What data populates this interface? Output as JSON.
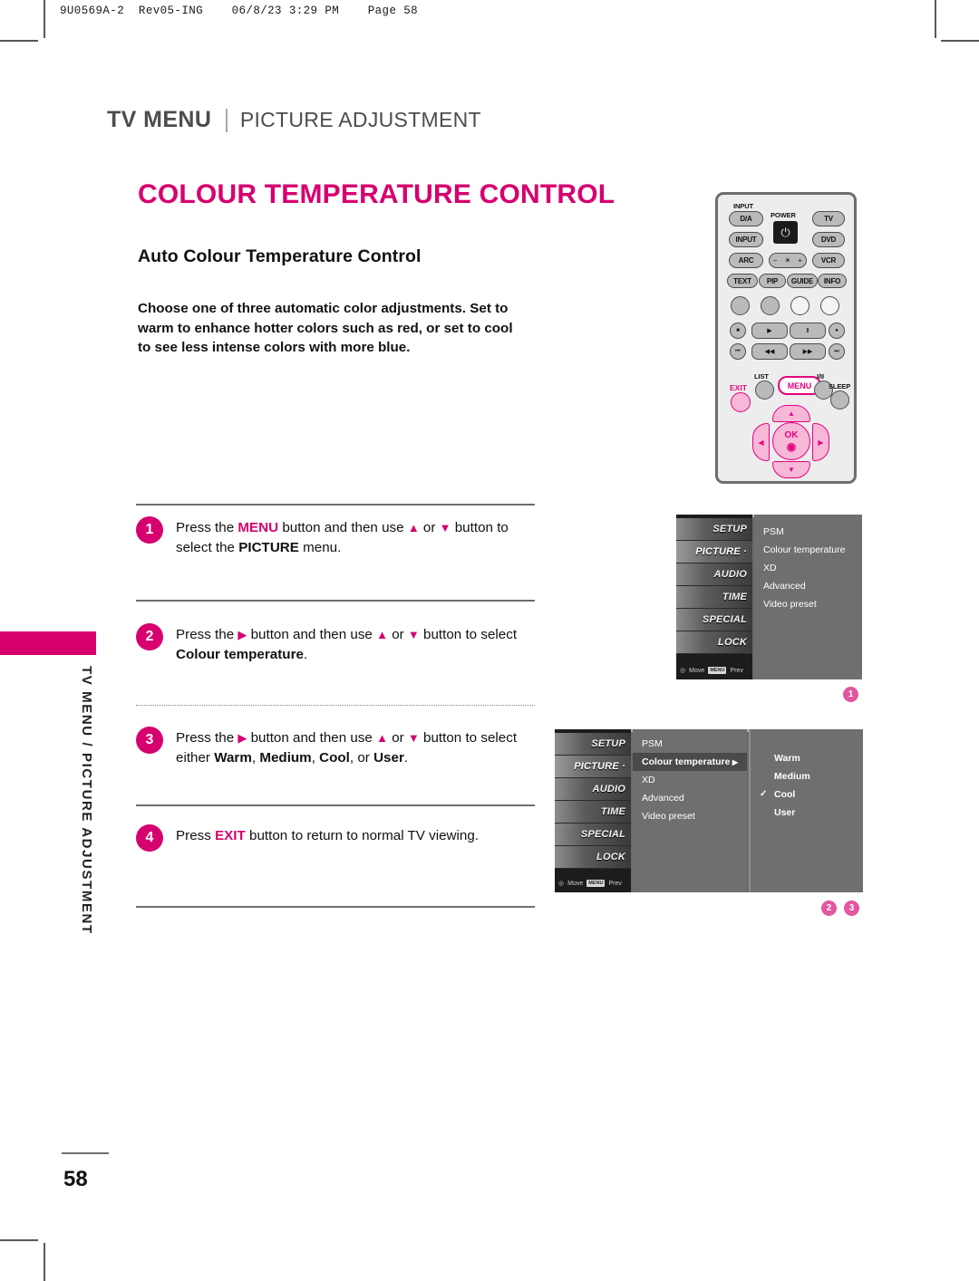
{
  "print_header": "9U0569A-2  Rev05-ING    06/8/23 3:29 PM    Page 58",
  "kicker": {
    "primary": "TV MENU",
    "secondary": "PICTURE ADJUSTMENT"
  },
  "title": "COLOUR TEMPERATURE CONTROL",
  "subtitle": "Auto Colour Temperature Control",
  "intro": "Choose one of three automatic color adjustments. Set to warm to enhance hotter colors such as red, or set to cool to see less intense colors with more blue.",
  "side_tab_text": "TV MENU / PICTURE ADJUSTMENT",
  "page_number": "58",
  "colors": {
    "accent": "#d6006f",
    "badge": "#e2579f",
    "header_gray": "#4d4d4f"
  },
  "steps": [
    {
      "number": "1",
      "parts": [
        {
          "t": "Press the ",
          "s": "n"
        },
        {
          "t": "MENU",
          "s": "pink"
        },
        {
          "t": " button and then use ",
          "s": "n"
        },
        {
          "t": "▲",
          "s": "tri"
        },
        {
          "t": " or ",
          "s": "n"
        },
        {
          "t": "▼",
          "s": "tri"
        },
        {
          "t": " button ",
          "s": "n"
        },
        {
          "t": "to select the ",
          "s": "n"
        },
        {
          "t": "PICTURE",
          "s": "b"
        },
        {
          "t": " menu.",
          "s": "n"
        }
      ]
    },
    {
      "number": "2",
      "parts": [
        {
          "t": "Press the ",
          "s": "n"
        },
        {
          "t": "▶",
          "s": "tri"
        },
        {
          "t": " button and then use ",
          "s": "n"
        },
        {
          "t": "▲",
          "s": "tri"
        },
        {
          "t": " or ",
          "s": "n"
        },
        {
          "t": "▼",
          "s": "tri"
        },
        {
          "t": " button to ",
          "s": "n"
        },
        {
          "t": "select ",
          "s": "n"
        },
        {
          "t": "Colour temperature",
          "s": "b"
        },
        {
          "t": ".",
          "s": "n"
        }
      ]
    },
    {
      "number": "3",
      "parts": [
        {
          "t": "Press the ",
          "s": "n"
        },
        {
          "t": "▶",
          "s": "tri"
        },
        {
          "t": " button and then use ",
          "s": "n"
        },
        {
          "t": "▲",
          "s": "tri"
        },
        {
          "t": " or ",
          "s": "n"
        },
        {
          "t": "▼",
          "s": "tri"
        },
        {
          "t": " button to ",
          "s": "n"
        },
        {
          "t": "select either ",
          "s": "n"
        },
        {
          "t": "Warm",
          "s": "b"
        },
        {
          "t": ", ",
          "s": "n"
        },
        {
          "t": "Medium",
          "s": "b"
        },
        {
          "t": ", ",
          "s": "n"
        },
        {
          "t": "Cool",
          "s": "b"
        },
        {
          "t": ", or ",
          "s": "n"
        },
        {
          "t": "User",
          "s": "b"
        },
        {
          "t": ".",
          "s": "n"
        }
      ]
    },
    {
      "number": "4",
      "parts": [
        {
          "t": "Press ",
          "s": "n"
        },
        {
          "t": "EXIT",
          "s": "pink"
        },
        {
          "t": " button to return to normal TV viewing.",
          "s": "n"
        }
      ]
    }
  ],
  "remote": {
    "label_input": "INPUT",
    "label_power": "POWER",
    "buttons": {
      "da": "D/A",
      "input": "INPUT",
      "arc": "ARC",
      "tv": "TV",
      "dvd": "DVD",
      "vcr": "VCR",
      "text": "TEXT",
      "pip": "PIP",
      "guide": "GUIDE",
      "info": "INFO"
    },
    "brightness": {
      "minus": "−",
      "icon": "☀",
      "plus": "+"
    },
    "transport": {
      "stop": "■",
      "play": "▶",
      "pause": "Ⅱ",
      "rec": "●",
      "prev": "⏮",
      "rew": "◀◀",
      "ff": "▶▶",
      "next": "⏭"
    },
    "list": "LIST",
    "menu": "MENU",
    "iii": "I/II",
    "sleep": "SLEEP",
    "exit": "EXIT",
    "ok": "OK",
    "nav": {
      "up": "▲",
      "down": "▼",
      "left": "◀",
      "right": "▶"
    }
  },
  "osd_common": {
    "menu_icons": [
      "SETUP",
      "PICTURE",
      "AUDIO",
      "TIME",
      "SPECIAL",
      "LOCK"
    ],
    "hint_move": "Move",
    "hint_key": "MENU",
    "hint_prev": "Prev"
  },
  "osd1": {
    "selected_icon": "PICTURE",
    "items": [
      "PSM",
      "Colour temperature",
      "XD",
      "Advanced",
      "Video preset"
    ],
    "badge": "1"
  },
  "osd2": {
    "selected_icon": "PICTURE",
    "items": [
      "PSM",
      "Colour temperature",
      "XD",
      "Advanced",
      "Video preset"
    ],
    "highlighted_item": "Colour temperature",
    "highlight_arrow": "▶",
    "options": [
      "Warm",
      "Medium",
      "Cool",
      "User"
    ],
    "checked_option": "Cool",
    "check_glyph": "✓",
    "badges": [
      "2",
      "3"
    ]
  }
}
